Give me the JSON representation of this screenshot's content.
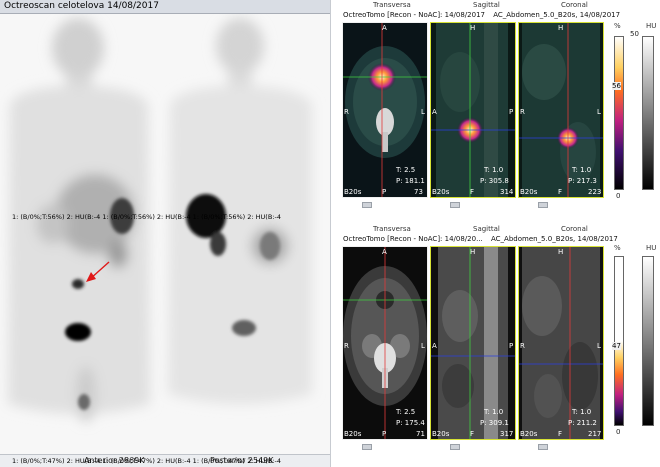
{
  "planar": {
    "title": "Octreoscan celotelova 14/08/2017",
    "anterior_caption": "Anterior 2869K",
    "posterior_caption": "Posterior 2549K"
  },
  "spect_top": {
    "tabs": [
      "Transversa",
      "Sagittal",
      "Coronal"
    ],
    "info": [
      "OctreoTomo [Recon - NoAC]: 14/08/2017",
      "AC_Abdomen_5.0_B20s, 14/08/2017"
    ],
    "scale_label": "%",
    "hu_label": "HU",
    "scale_max": "50",
    "scale_value": "56",
    "scale_min": "0",
    "transversal": {
      "top": "A",
      "left": "R",
      "right": "L",
      "bottom": "P",
      "t_value": "T: 2.5",
      "p_value": "P: 181.1",
      "kernel": "B20s",
      "slice": "73"
    },
    "sagittal": {
      "top": "H",
      "left": "A",
      "right": "P",
      "bottom": "F",
      "t_value": "T: 1.0",
      "p_value": "P: 305.8",
      "kernel": "B20s",
      "slice": "314"
    },
    "coronal": {
      "top": "H",
      "left": "R",
      "right": "L",
      "bottom": "F",
      "t_value": "T: 1.0",
      "p_value": "P: 217.3",
      "kernel": "B20s",
      "slice": "223"
    },
    "legend": "1: (B/0%;T:56%) 2: HU(B:-4 1: (B/0%;T:56%) 2: HU(B:-4 1: (B/0%;T:56%) 2: HU(B:-4"
  },
  "spect_bottom": {
    "tabs": [
      "Transversa",
      "Sagittal",
      "Coronal"
    ],
    "info": [
      "OctreoTomo [Recon - NoAC]: 14/08/20...",
      "AC_Abdomen_5.0_B20s, 14/08/2017"
    ],
    "scale_label": "%",
    "hu_label": "HU",
    "scale_value": "47",
    "scale_min": "0",
    "transversal": {
      "top": "A",
      "left": "R",
      "right": "L",
      "bottom": "P",
      "t_value": "T: 2.5",
      "p_value": "P: 175.4",
      "kernel": "B20s",
      "slice": "71"
    },
    "sagittal": {
      "top": "H",
      "left": "A",
      "right": "P",
      "bottom": "F",
      "t_value": "T: 1.0",
      "p_value": "P: 309.1",
      "kernel": "B20s",
      "slice": "317"
    },
    "coronal": {
      "top": "H",
      "left": "R",
      "right": "L",
      "bottom": "F",
      "t_value": "T: 1.0",
      "p_value": "P: 211.2",
      "kernel": "B20s",
      "slice": "217"
    },
    "legend": "1: (B/0%;T:47%) 2: HU(B:-4 1: (B/0%;T:47%) 2: HU(B:-4 1: (B/0%;T:47%) 2: HU(B:-4"
  },
  "colors": {
    "crosshair_h": "#2b3fe0",
    "crosshair_v": "#e23a3a",
    "crosshair_green": "#3fcf3f",
    "frame": "#d7e234",
    "arrow": "#e01818"
  }
}
